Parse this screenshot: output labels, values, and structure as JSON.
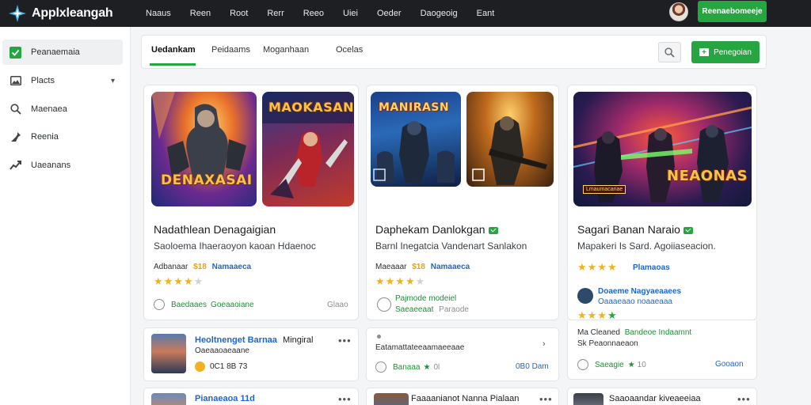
{
  "app": {
    "name": "Applxleangah",
    "logo_icon": "star-compass-icon"
  },
  "topnav": [
    "Naaus",
    "Reen",
    "Root",
    "Rerr",
    "Reeo",
    "Uiei",
    "Oeder",
    "Daogeoig",
    "Eant"
  ],
  "top_cta": "Reenaebomeeje",
  "sidebar": {
    "items": [
      {
        "label": "Peanaemaia",
        "icon": "check-square-icon",
        "active": true
      },
      {
        "label": "Placts",
        "icon": "image-icon",
        "chevron": true
      },
      {
        "label": "Maenaea",
        "icon": "search-icon"
      },
      {
        "label": "Reenia",
        "icon": "pin-icon"
      },
      {
        "label": "Uaeanans",
        "icon": "trend-icon"
      }
    ]
  },
  "tabs": [
    "Uedankam",
    "Peidaams",
    "Moganhaan",
    "Ocelas"
  ],
  "tab_cta": "Penegoian",
  "cards": [
    {
      "thumb_titles": [
        "DENAXASAI",
        "MAOKASAN"
      ],
      "title": "Nadathlean Denagaigian",
      "subtitle": "Saoloema Ihaeraoyon kaoan Hdaenoc",
      "meta_label": "Adbanaar",
      "meta_price": "$18",
      "meta_tag": "Namaaeca",
      "rating": 4,
      "footer_left": "Baedaaes",
      "footer_mid": "Goeaaoiane",
      "footer_right": "Glaao"
    },
    {
      "thumb_titles": [
        "MANIRASN",
        ""
      ],
      "title": "Daphekam Danlokgan",
      "subtitle": "Barnl Inegatcia Vandenart Sanlakon",
      "meta_label": "Maeaaar",
      "meta_price": "$18",
      "meta_tag": "Namaaeca",
      "rating": 4,
      "footer_line1": "Pajmode modeiel",
      "footer_line2": "Saeaeeaat",
      "footer_line2b": "Paraode"
    },
    {
      "thumb_titles": [
        "NEAONAS"
      ],
      "thumb_badge": "Lmaumacariae",
      "title": "Sagari Banan Naraio",
      "subtitle": "Mapakeri Is Sard. Agoiiaseacion.",
      "meta_tag": "Plamaoas",
      "rating": 4,
      "author_name": "Doaeme Nagyaeaaees",
      "author_sub": "Oaaaeaao noaaeaaa",
      "rating2": 4,
      "extra_label": "Ma Cleaned",
      "extra_value": "Bandeoe Indaamnt",
      "extra_sub": "Sk Peaonnaeaon",
      "footer_left": "Saeagie",
      "footer_rating": "10",
      "footer_right": "Gooaon"
    }
  ],
  "rows": [
    {
      "title": "Heoltnenget Barnaa",
      "title2": "Mingiral",
      "sub": "Oaeaaoaeaane",
      "meta": "0C1 8B 73"
    },
    {
      "title": "Eatamattateeaamaeeaae",
      "footer_left": "Banaaa",
      "footer_rating": "0l",
      "footer_right": "0B0 Dam"
    },
    {
      "title": "Pianaeaoa 11d"
    },
    {
      "title": "Faaaanianot Nanna Pialaan"
    },
    {
      "title": "Saaoaandar kiveaeeiaa"
    }
  ]
}
